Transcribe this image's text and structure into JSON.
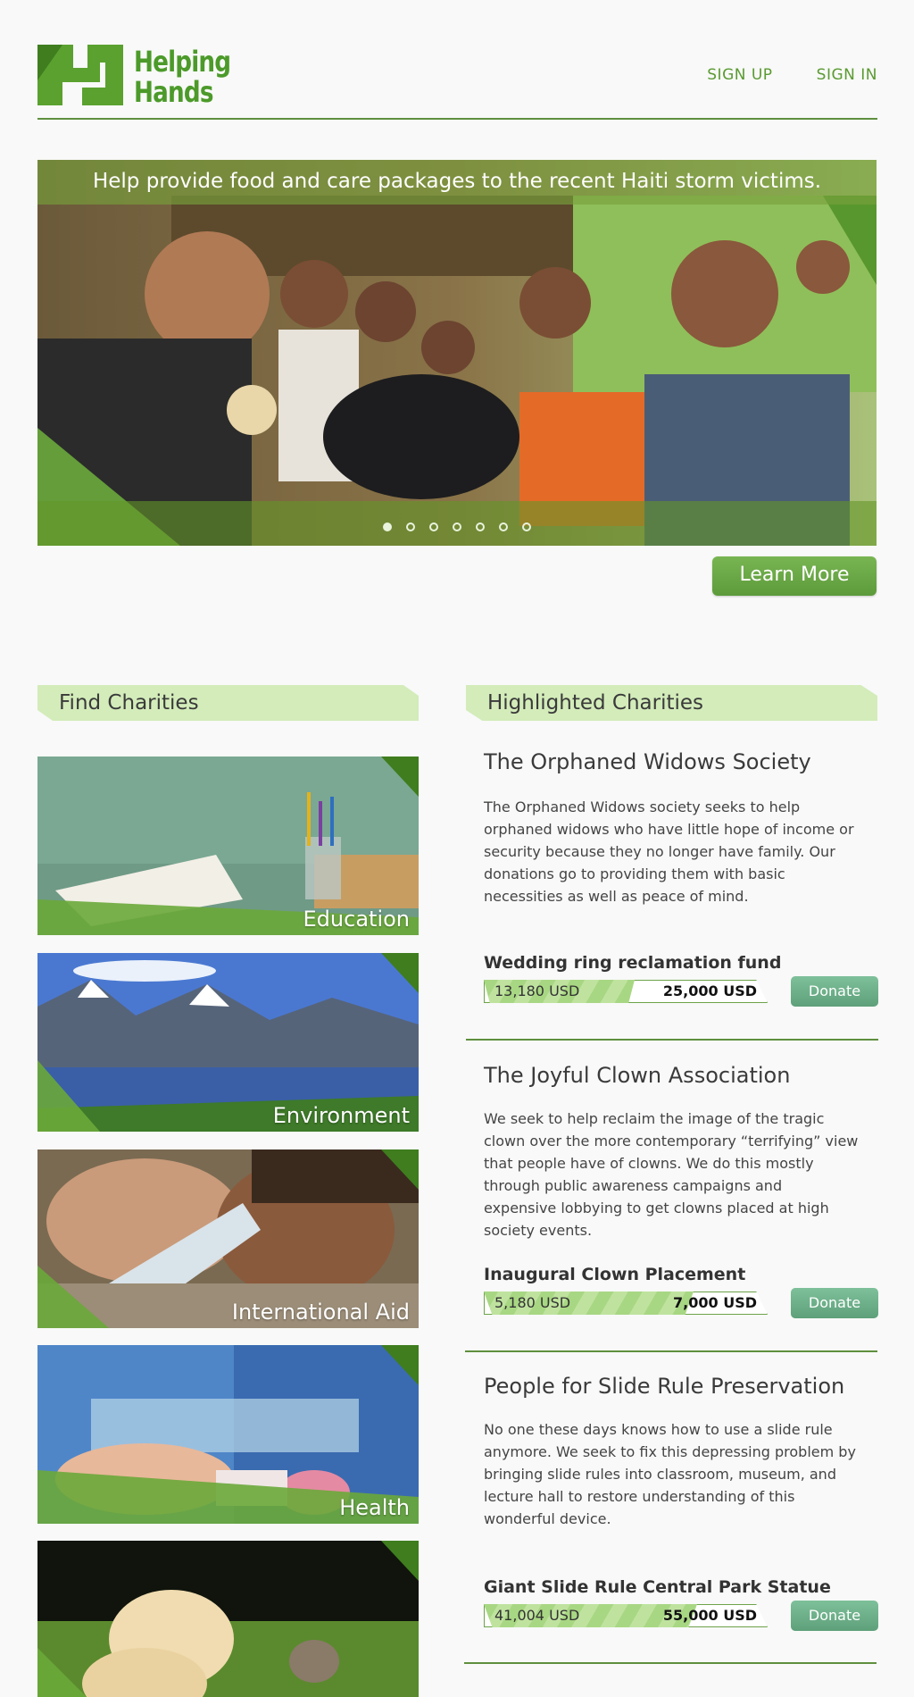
{
  "brand": {
    "logo_line1": "Helping",
    "logo_line2": "Hands",
    "color": "#4c9a2a"
  },
  "nav": {
    "sign_up": "SIGN UP",
    "sign_in": "SIGN IN"
  },
  "hero": {
    "caption": "Help provide food and care packages to the recent Haiti storm victims.",
    "slide_count": 7,
    "active_slide": 1,
    "learn_more": "Learn More"
  },
  "find_charities": {
    "heading": "Find Charities",
    "categories": [
      "Education",
      "Environment",
      "International Aid",
      "Health",
      ""
    ]
  },
  "highlighted": {
    "heading": "Highlighted Charities",
    "charities": [
      {
        "title": "The Orphaned Widows Society",
        "description": "The Orphaned Widows society seeks to help orphaned widows who have little hope of income or security because they no longer have family. Our donations go to providing them with basic necessities as well as peace of mind.",
        "fund": "Wedding ring reclamation fund",
        "raised": "13,180 USD",
        "goal": "25,000 USD",
        "progress": 0.53,
        "donate": "Donate"
      },
      {
        "title": "The Joyful Clown Association",
        "description": "We seek to help reclaim the image of the tragic clown over the more contemporary “terrifying” view that people have of clowns. We do this mostly through public awareness campaigns and expensive lobbying to get clowns placed at high society events.",
        "fund": "Inaugural Clown Placement",
        "raised": "5,180 USD",
        "goal": "7,000 USD",
        "progress": 0.74,
        "donate": "Donate"
      },
      {
        "title": "People for Slide Rule Preservation",
        "description": "No one these days knows how to use a slide rule anymore. We seek to fix this depressing problem by bringing slide rules into classroom, museum, and lecture hall to restore understanding of this wonderful device.",
        "fund": "Giant Slide Rule Central Park Statue",
        "raised": "41,004 USD",
        "goal": "55,000 USD",
        "progress": 0.75,
        "donate": "Donate"
      }
    ]
  }
}
